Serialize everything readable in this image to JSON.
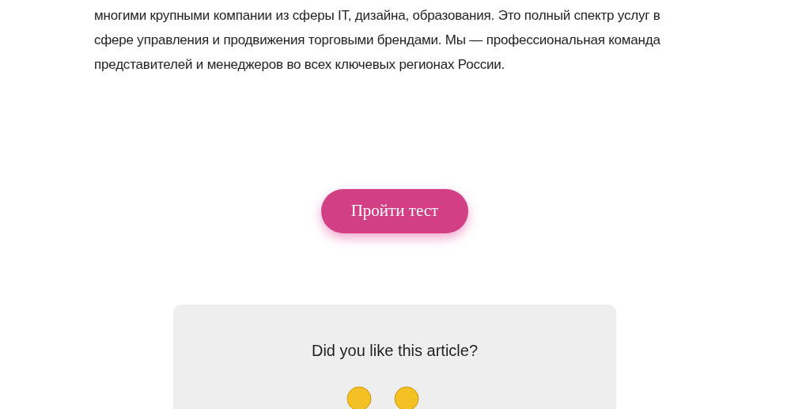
{
  "article": {
    "paragraph": "многими крупными компании из сферы IT, дизайна, образования. Это полный спектр услуг в сфере управления и продвижения торговыми брендами. Мы — профессиональная команда представителей и менеджеров во всех ключевых регионах России."
  },
  "cta_button": {
    "label": "Пройти тест"
  },
  "feedback": {
    "question": "Did you like this article?",
    "reactions": [
      {
        "kind": "emoji"
      },
      {
        "kind": "emoji"
      }
    ]
  }
}
